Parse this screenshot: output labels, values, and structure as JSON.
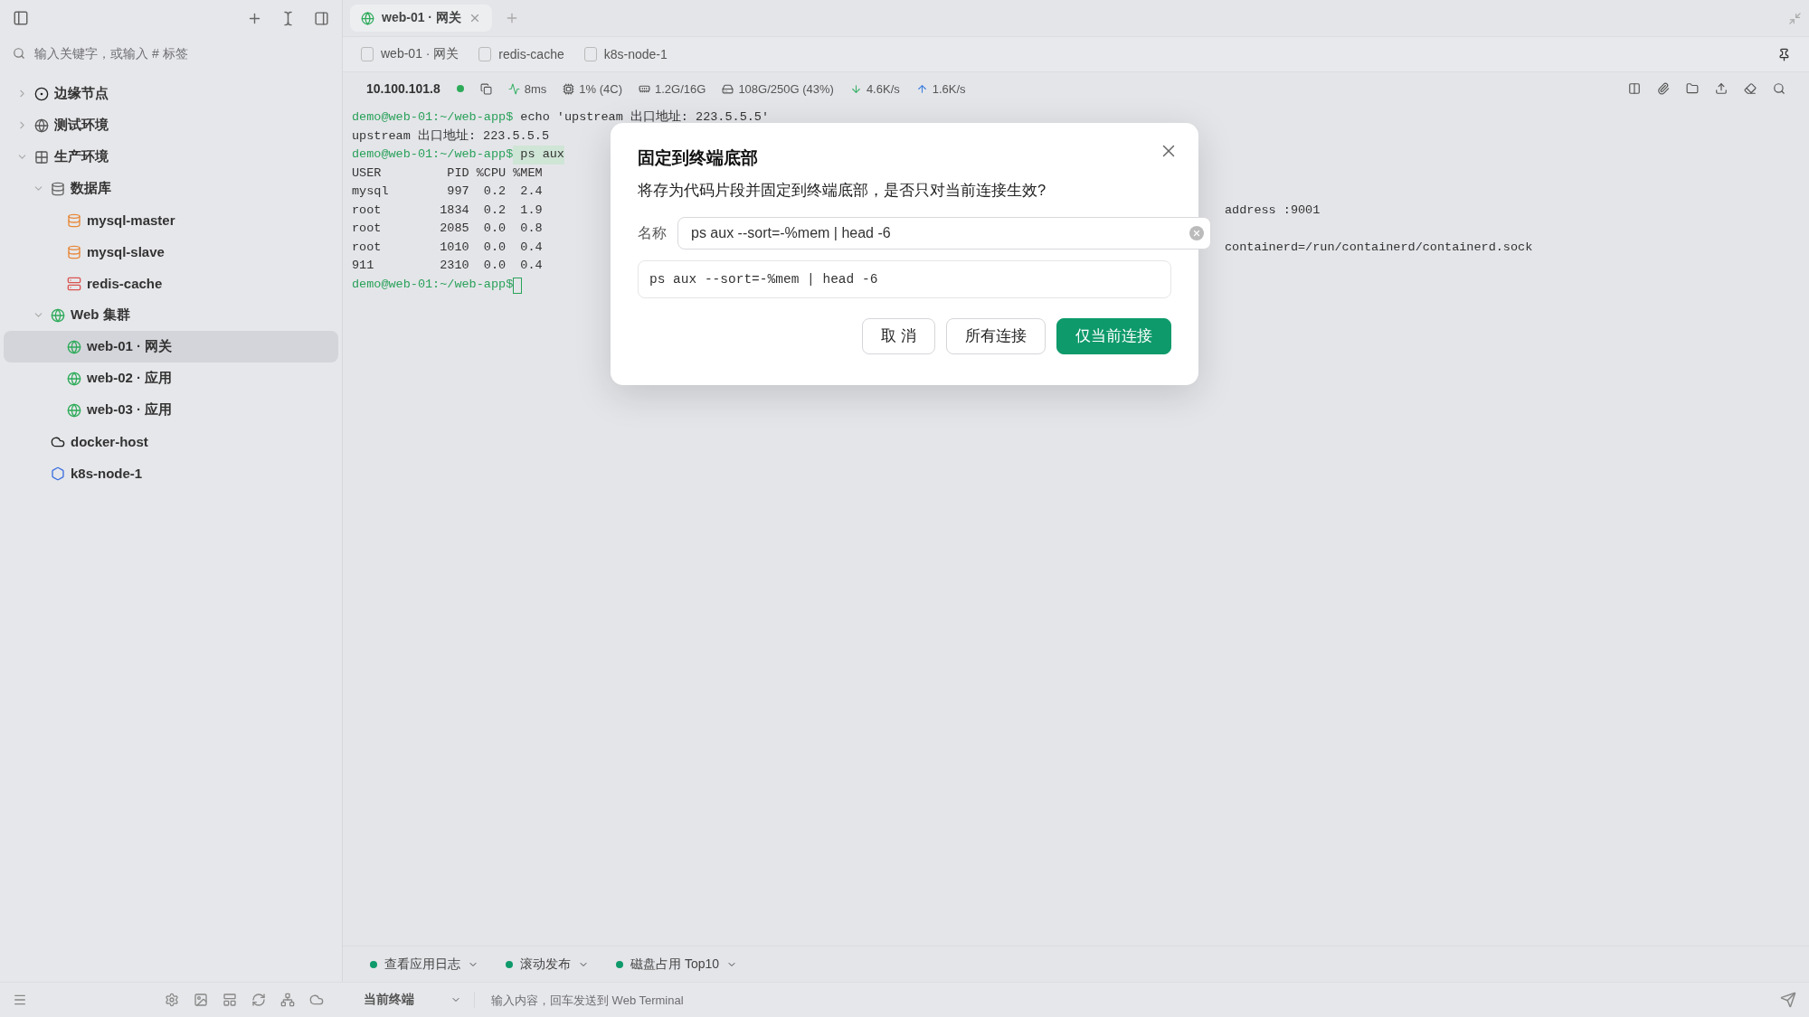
{
  "sidebar": {
    "search": {
      "placeholder": "输入关键字，或输入 # 标签"
    },
    "tree": [
      {
        "label": "边缘节点",
        "kind": "edge",
        "expanded": false,
        "selected": false
      },
      {
        "label": "测试环境",
        "kind": "env",
        "expanded": false,
        "selected": false
      },
      {
        "label": "生产环境",
        "kind": "grid",
        "expanded": true,
        "selected": false,
        "children": [
          {
            "label": "数据库",
            "kind": "db",
            "expanded": true,
            "selected": false,
            "children": [
              {
                "label": "mysql-master",
                "kind": "mysql",
                "selected": false
              },
              {
                "label": "mysql-slave",
                "kind": "mysql",
                "selected": false
              },
              {
                "label": "redis-cache",
                "kind": "redis",
                "selected": false
              }
            ]
          },
          {
            "label": "Web 集群",
            "kind": "web",
            "expanded": true,
            "selected": false,
            "children": [
              {
                "label": "web-01 · 网关",
                "kind": "web",
                "selected": true
              },
              {
                "label": "web-02 · 应用",
                "kind": "web",
                "selected": false
              },
              {
                "label": "web-03 · 应用",
                "kind": "web",
                "selected": false
              }
            ]
          },
          {
            "label": "docker-host",
            "kind": "docker",
            "selected": false
          },
          {
            "label": "k8s-node-1",
            "kind": "k8s",
            "selected": false
          }
        ]
      }
    ]
  },
  "tabs": [
    {
      "label": "web-01 · 网关",
      "selected": true
    }
  ],
  "recent": [
    {
      "label": "web-01 · 网关"
    },
    {
      "label": "redis-cache"
    },
    {
      "label": "k8s-node-1"
    }
  ],
  "status": {
    "host": "10.100.101.8",
    "metrics": [
      {
        "kind": "latency",
        "text": "8ms"
      },
      {
        "kind": "cpu",
        "text": "1% (4C)"
      },
      {
        "kind": "mem",
        "text": "1.2G/16G"
      },
      {
        "kind": "disk",
        "text": "108G/250G (43%)"
      },
      {
        "kind": "down",
        "text": "4.6K/s"
      },
      {
        "kind": "up",
        "text": "1.6K/s"
      }
    ]
  },
  "terminal": {
    "lines": [
      {
        "kind": "prompt",
        "prompt": "demo@web-01:~/web-app$",
        "text": " echo 'upstream 出口地址: 223.5.5.5'"
      },
      {
        "kind": "output",
        "text": "upstream 出口地址: 223.5.5.5"
      },
      {
        "kind": "prompt",
        "prompt": "demo@web-01:~/web-app$",
        "text": " ps aux"
      },
      {
        "kind": "output",
        "text": "USER         PID %CPU %MEM"
      },
      {
        "kind": "output",
        "text": "mysql        997  0.2  2.4"
      },
      {
        "kind": "output",
        "text": "root        1834  0.2  1.9",
        "tail": "address :9001"
      },
      {
        "kind": "output",
        "text": "root        2085  0.0  0.8"
      },
      {
        "kind": "output",
        "text": "root        1010  0.0  0.4",
        "tail": "containerd=/run/containerd/containerd.sock"
      },
      {
        "kind": "output",
        "text": "911         2310  0.0  0.4"
      },
      {
        "kind": "prompt",
        "prompt": "demo@web-01:~/web-app$",
        "cursor": true
      }
    ]
  },
  "snippets": [
    {
      "label": "查看应用日志"
    },
    {
      "label": "滚动发布"
    },
    {
      "label": "磁盘占用 Top10"
    }
  ],
  "input_bar": {
    "target": "当前终端",
    "placeholder": "输入内容，回车发送到 Web Terminal"
  },
  "dialog": {
    "title": "固定到终端底部",
    "message": "将存为代码片段并固定到终端底部，是否只对当前连接生效?",
    "name_label": "名称",
    "name_value": "ps aux --sort=-%mem | head -6",
    "command": "ps aux --sort=-%mem | head -6",
    "buttons": [
      {
        "label": "取 消",
        "kind": "plain"
      },
      {
        "label": "所有连接",
        "kind": "plain"
      },
      {
        "label": "仅当前连接",
        "kind": "primary"
      }
    ]
  }
}
